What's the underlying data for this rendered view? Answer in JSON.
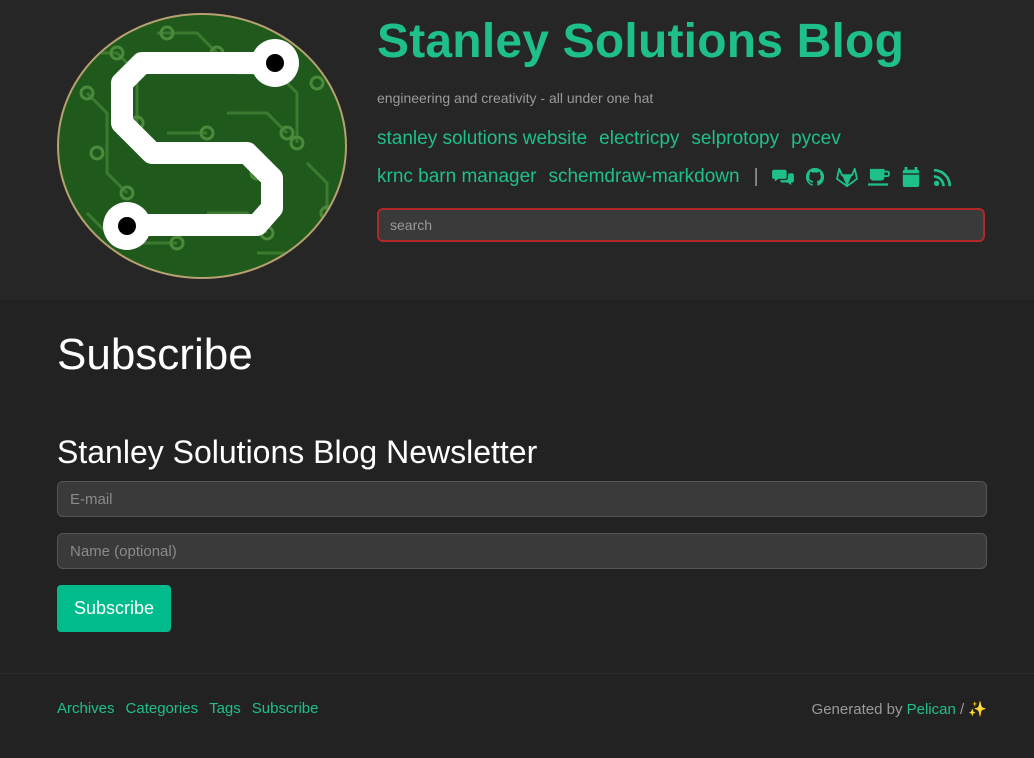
{
  "site": {
    "title": "Stanley Solutions Blog",
    "tagline": "engineering and creativity - all under one hat"
  },
  "nav": {
    "row1": [
      "stanley solutions website",
      "electricpy",
      "selprotopy",
      "pycev"
    ],
    "row2": [
      "krnc barn manager",
      "schemdraw-markdown"
    ],
    "separator": "|",
    "icons": [
      "comments-icon",
      "github-icon",
      "gitlab-icon",
      "coffee-icon",
      "calendar-icon",
      "rss-icon"
    ]
  },
  "search": {
    "placeholder": "search",
    "value": ""
  },
  "page": {
    "heading": "Subscribe",
    "newsletter_heading": "Stanley Solutions Blog Newsletter",
    "email_placeholder": "E-mail",
    "name_placeholder": "Name (optional)",
    "subscribe_label": "Subscribe"
  },
  "footer": {
    "links": [
      "Archives",
      "Categories",
      "Tags",
      "Subscribe"
    ],
    "generated_prefix": "Generated by ",
    "generated_link": "Pelican",
    "generated_suffix": " / ✨"
  },
  "colors": {
    "accent": "#1fbf8c",
    "button": "#00bc8c",
    "background": "#222222",
    "search_border": "#b02828"
  }
}
